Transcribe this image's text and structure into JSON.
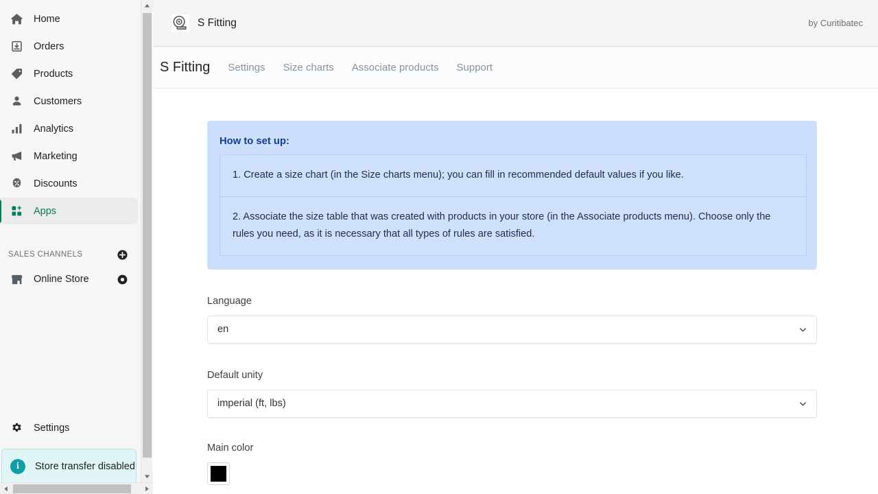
{
  "sidebar": {
    "nav": [
      {
        "label": "Home",
        "icon": "home-icon",
        "active": false
      },
      {
        "label": "Orders",
        "icon": "orders-icon",
        "active": false
      },
      {
        "label": "Products",
        "icon": "products-tag-icon",
        "active": false
      },
      {
        "label": "Customers",
        "icon": "customers-person-icon",
        "active": false
      },
      {
        "label": "Analytics",
        "icon": "analytics-bar-chart-icon",
        "active": false
      },
      {
        "label": "Marketing",
        "icon": "marketing-megaphone-icon",
        "active": false
      },
      {
        "label": "Discounts",
        "icon": "discounts-percent-icon",
        "active": false
      },
      {
        "label": "Apps",
        "icon": "apps-grid-icon",
        "active": true
      }
    ],
    "sales_channels_label": "SALES CHANNELS",
    "online_store_label": "Online Store",
    "settings_label": "Settings",
    "transfer_banner_label": "Store transfer disabled",
    "active_color": "#008060"
  },
  "topbar": {
    "app_title": "S Fitting",
    "app_icon": "measuring-tape-icon",
    "by_label": "by Curitibatec"
  },
  "tabs": {
    "title": "S Fitting",
    "links": [
      "Settings",
      "Size charts",
      "Associate products",
      "Support"
    ]
  },
  "howto": {
    "title": "How to set up:",
    "steps": [
      "1. Create a size chart (in the Size charts menu); you can fill in recommended default values if you like.",
      "2. Associate the size table that was created with products in your store (in the Associate products menu). Choose only the rules you need, as it is necessary that all types of rules are satisfied."
    ],
    "bg_color": "#cddffc",
    "title_color": "#103d8e"
  },
  "form": {
    "language": {
      "label": "Language",
      "value": "en"
    },
    "default_unity": {
      "label": "Default unity",
      "value": "imperial (ft, lbs)"
    },
    "main_color": {
      "label": "Main color",
      "value": "#000000"
    }
  }
}
